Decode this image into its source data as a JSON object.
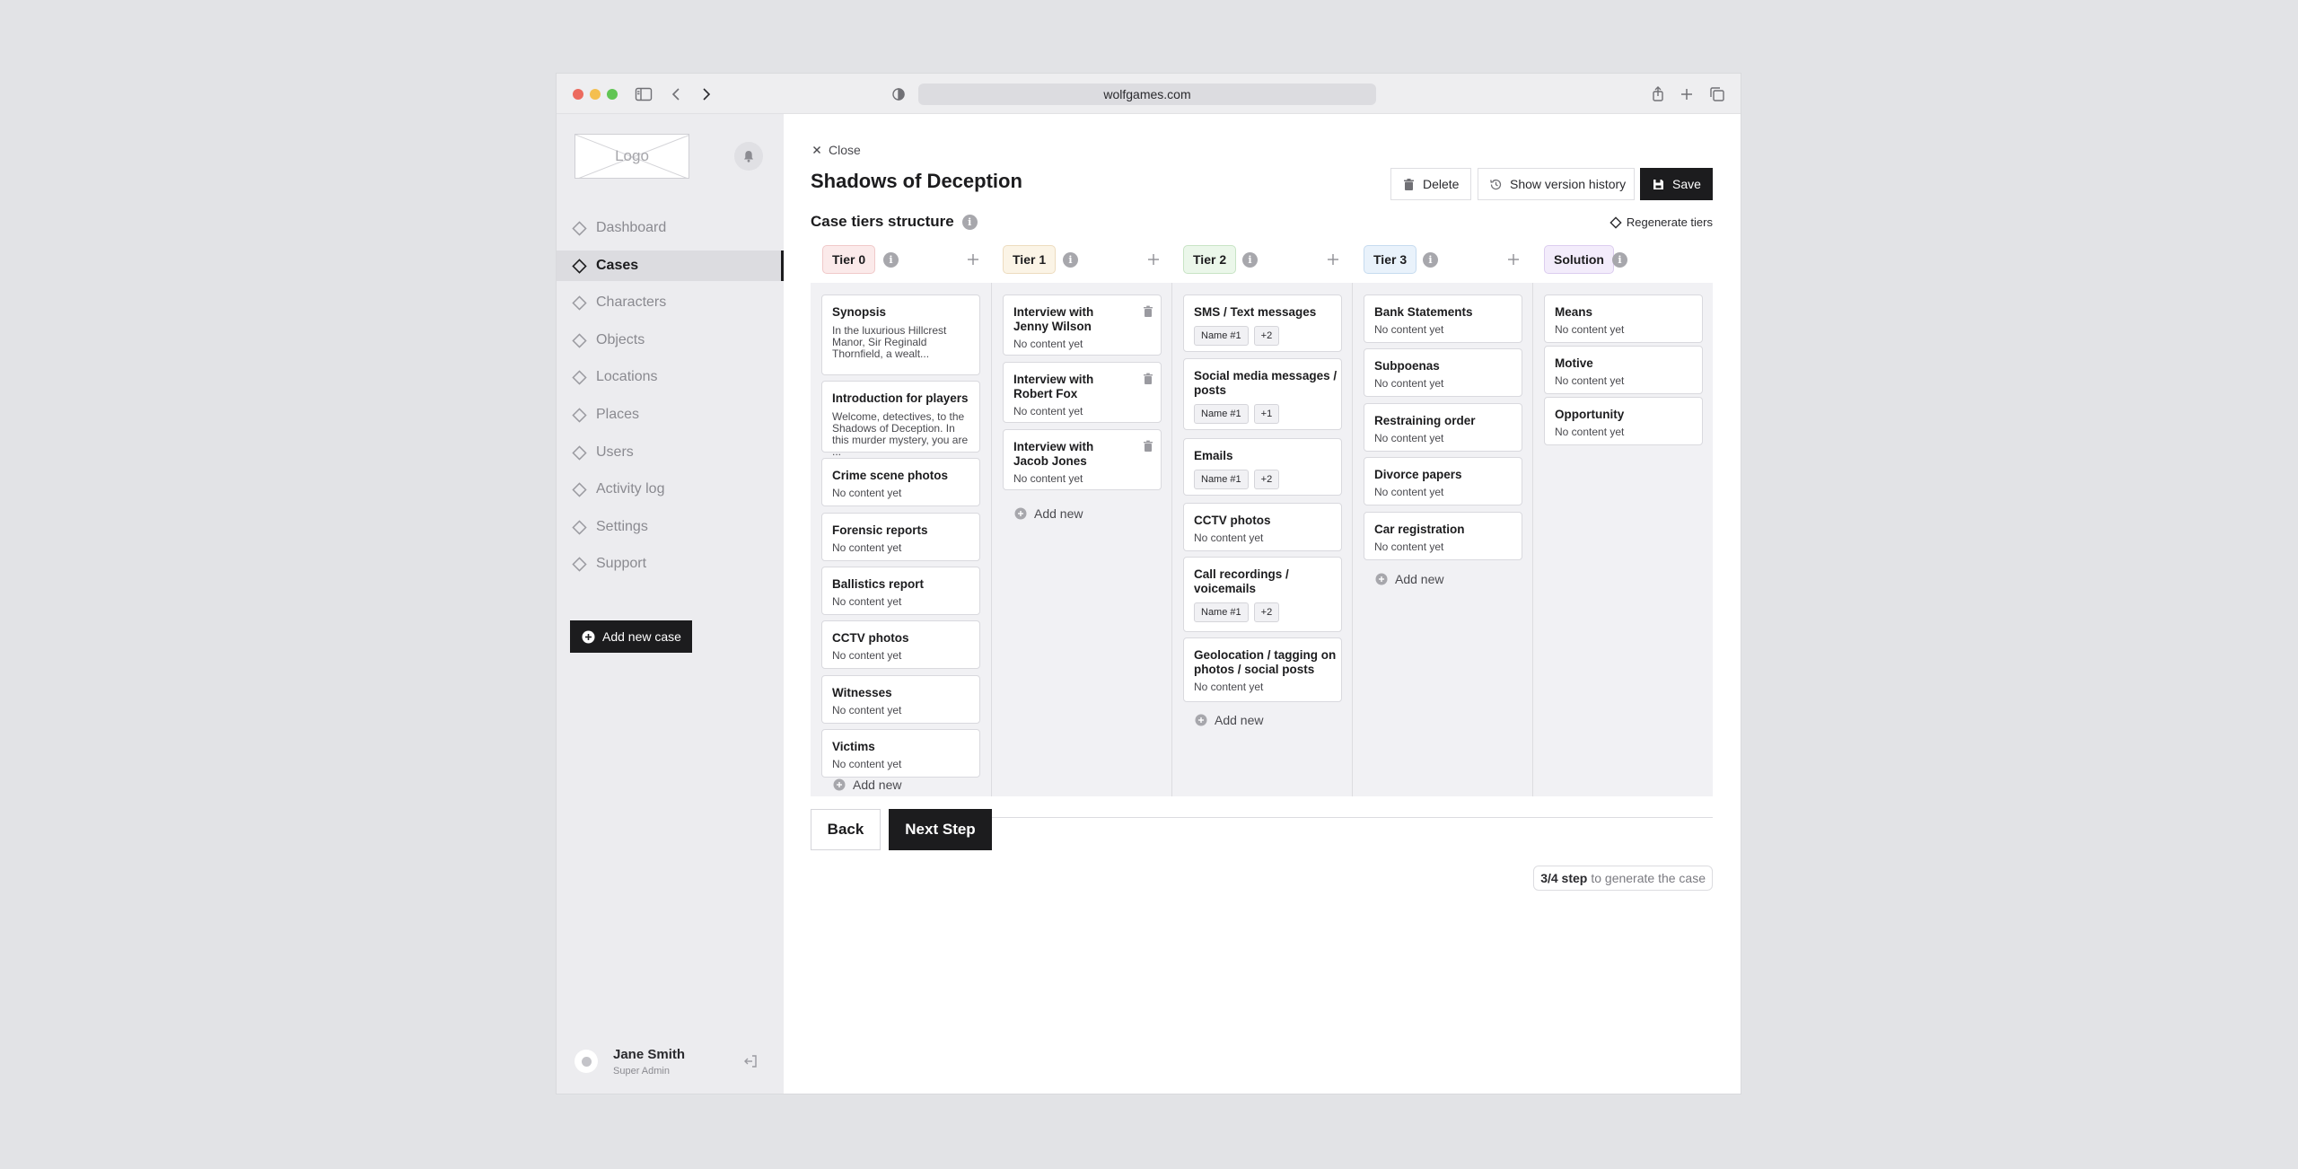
{
  "browser": {
    "url": "wolfgames.com"
  },
  "sidebar": {
    "logo": "Logo",
    "items": [
      {
        "label": "Dashboard",
        "active": false
      },
      {
        "label": "Cases",
        "active": true
      },
      {
        "label": "Characters",
        "active": false
      },
      {
        "label": "Objects",
        "active": false
      },
      {
        "label": "Locations",
        "active": false
      },
      {
        "label": "Places",
        "active": false
      },
      {
        "label": "Users",
        "active": false
      },
      {
        "label": "Activity log",
        "active": false
      },
      {
        "label": "Settings",
        "active": false
      },
      {
        "label": "Support",
        "active": false
      }
    ],
    "add_case": "Add new case",
    "user": {
      "name": "Jane Smith",
      "role": "Super Admin"
    }
  },
  "main": {
    "close": "Close",
    "title": "Shadows of Deception",
    "buttons": {
      "delete": "Delete",
      "history": "Show version history",
      "save": "Save"
    },
    "section_title": "Case tiers structure",
    "info_glyph": "i",
    "regenerate": "Regenerate tiers",
    "add_new": "Add new",
    "columns": [
      {
        "tag": "Tier 0",
        "color": "#fbeaea",
        "border": "#f0c9c9",
        "cards": [
          {
            "title": "Synopsis",
            "text": "In the luxurious Hillcrest Manor, Sir Reginald Thornfield, a wealt..."
          },
          {
            "title": "Introduction for players",
            "text": "Welcome, detectives, to the Shadows of Deception. In this murder mystery, you are ..."
          },
          {
            "title": "Crime scene photos",
            "text": "No content yet"
          },
          {
            "title": "Forensic reports",
            "text": "No content yet"
          },
          {
            "title": "Ballistics report",
            "text": "No content yet"
          },
          {
            "title": "CCTV photos",
            "text": "No content yet"
          },
          {
            "title": "Witnesses",
            "text": "No content yet"
          },
          {
            "title": "Victims",
            "text": "No content yet"
          }
        ]
      },
      {
        "tag": "Tier 1",
        "color": "#fbf4e6",
        "border": "#eddcbf",
        "cards": [
          {
            "title": "Interview with Jenny Wilson",
            "text": "No content yet"
          },
          {
            "title": "Interview with Robert Fox",
            "text": "No content yet"
          },
          {
            "title": "Interview with Jacob Jones",
            "text": "No content yet"
          }
        ]
      },
      {
        "tag": "Tier 2",
        "color": "#ebf7ea",
        "border": "#c8e4c5",
        "cards": [
          {
            "title": "SMS / Text messages",
            "chips": [
              "Name #1",
              "+2"
            ]
          },
          {
            "title": "Social media messages / posts",
            "chips": [
              "Name #1",
              "+1"
            ]
          },
          {
            "title": "Emails",
            "chips": [
              "Name #1",
              "+2"
            ]
          },
          {
            "title": "CCTV photos",
            "text": "No content yet"
          },
          {
            "title": "Call recordings / voicemails",
            "chips": [
              "Name #1",
              "+2"
            ]
          },
          {
            "title": "Geolocation / tagging on photos / social posts",
            "text": "No content yet"
          }
        ]
      },
      {
        "tag": "Tier 3",
        "color": "#e9f2fb",
        "border": "#c6dbef",
        "cards": [
          {
            "title": "Bank Statements",
            "text": "No content yet"
          },
          {
            "title": "Subpoenas",
            "text": "No content yet"
          },
          {
            "title": "Restraining order",
            "text": "No content yet"
          },
          {
            "title": "Divorce papers",
            "text": "No content yet"
          },
          {
            "title": "Car registration",
            "text": "No content yet"
          }
        ]
      },
      {
        "tag": "Solution",
        "color": "#f3ecfb",
        "border": "#dccdef",
        "cards": [
          {
            "title": "Means",
            "text": "No content yet"
          },
          {
            "title": "Motive",
            "text": "No content yet"
          },
          {
            "title": "Opportunity",
            "text": "No content yet"
          }
        ]
      }
    ],
    "footer": {
      "back": "Back",
      "next": "Next Step",
      "step_count": "3/4 step",
      "step_text": "to generate the case"
    }
  }
}
